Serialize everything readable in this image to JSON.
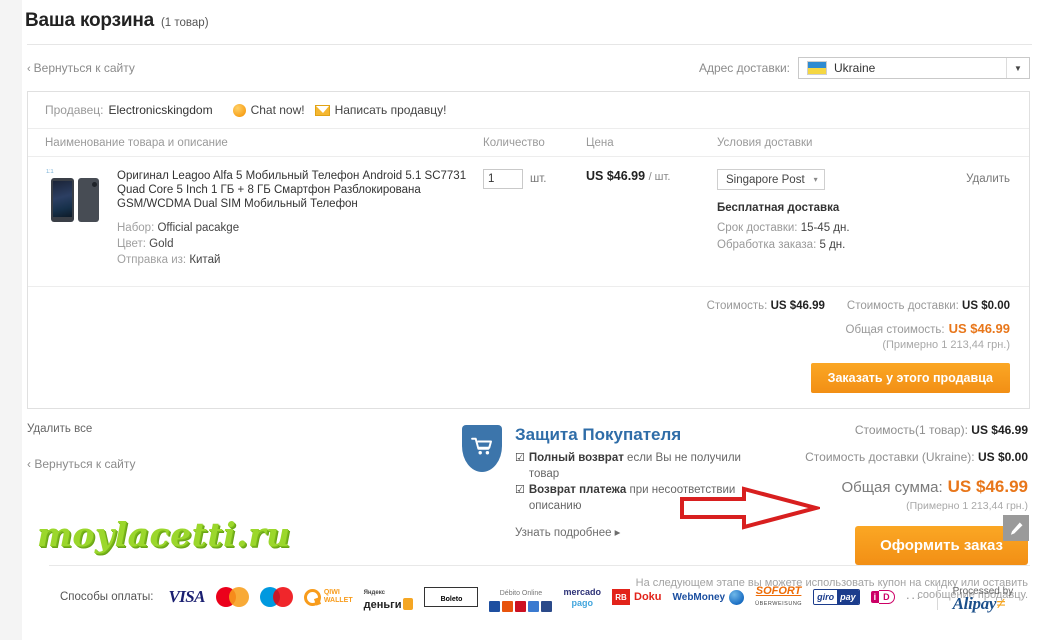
{
  "header": {
    "title": "Ваша корзина",
    "count": "(1 товар)"
  },
  "topbar": {
    "back_link": "Вернуться к сайту",
    "back_chevron": "‹",
    "shipping_address_label": "Адрес доставки:",
    "shipping_country": "Ukraine",
    "shipping_flag_icon": "ukraine-flag-icon",
    "dropdown_arrow": "▼"
  },
  "seller": {
    "label": "Продавец:",
    "name": "Electronicskingdom",
    "chat_label": "Chat now!",
    "chat_icon": "chat-bubble-icon",
    "mail_label": "Написать продавцу!",
    "mail_icon": "envelope-icon"
  },
  "columns": {
    "description": "Наименование товара и описание",
    "quantity": "Количество",
    "price": "Цена",
    "shipping": "Условия доставки"
  },
  "item": {
    "thumb_badge": "1:1",
    "title": "Оригинал Leagoo Alfa 5 Мобильный Телефон Android 5.1 SC7731 Quad Core 5 Inch 1 ГБ + 8 ГБ Смартфон Разблокирована GSM/WCDMA Dual SIM Mo­бильный Телефон",
    "attrs": [
      {
        "label": "Набор:",
        "value": "Official pacakge"
      },
      {
        "label": "Цвет:",
        "value": "Gold"
      },
      {
        "label": "Отправка из:",
        "value": "Китай"
      }
    ],
    "qty_value": "1",
    "qty_unit": "шт.",
    "price": "US $46.99",
    "price_per": "/ шт.",
    "ship_method": "Singapore Post",
    "ship_arrow": "▾",
    "free_shipping": "Бесплатная доставка",
    "ship_time_label": "Срок доставки:",
    "ship_time_value": "15-45 дн.",
    "process_label": "Обработка заказа:",
    "process_value": "5 дн.",
    "delete_label": "Удалить"
  },
  "card_footer": {
    "cost_label": "Стоимость:",
    "cost_value": "US $46.99",
    "ship_cost_label": "Стоимость доставки:",
    "ship_cost_value": "US $0.00",
    "total_label": "Общая стоимость:",
    "total_value": "US $46.99",
    "approx": "(Примерно 1 213,44 грн.)",
    "order_button": "Заказать у этого продавца"
  },
  "mid": {
    "delete_all": "Удалить все",
    "back_link": "Вернуться к сайту",
    "back_chevron": "‹",
    "watermark": "moylacetti.ru"
  },
  "protection": {
    "shield_icon": "shield-cart-icon",
    "title": "Защита Покупателя",
    "items": [
      {
        "check": "☑",
        "strong": "Полный возврат",
        "rest": " если Вы не получили товар"
      },
      {
        "check": "☑",
        "strong": "Возврат платежа",
        "rest": " при несоответствии описанию"
      }
    ],
    "more_link": "Узнать подробнее ▸"
  },
  "summary": {
    "cost_label": "Стоимость(1 товар):",
    "cost_value": "US $46.99",
    "ship_label": "Стоимость доставки (Ukraine):",
    "ship_value": "US $0.00",
    "grand_label": "Общая сумма:",
    "grand_value": "US $46.99",
    "grand_approx": "(Примерно 1 213,44 грн.)",
    "checkout_button": "Оформить заказ",
    "next_step_note": "На следующем этапе вы можете использовать купон на скидку или оставить сообщение продавцу."
  },
  "annotation": {
    "arrow_color": "#d81f1f",
    "arrow_icon": "red-arrow-right-annotation",
    "edit_tool_icon": "pencil-icon"
  },
  "payments": {
    "label": "Способы оплаты:",
    "methods": [
      "VISA",
      "MasterCard",
      "Maestro",
      "QIWI WALLET",
      "Яндекс.Деньги",
      "Boleto",
      "Débito Online",
      "mercado pago",
      "Doku",
      "WebMoney",
      "SOFORT ÜBERWEISUNG",
      "giropay",
      "iDEAL"
    ],
    "more": "···",
    "processed_by": "Processed by",
    "processor": "Alipay",
    "visa_text": "VISA",
    "mastercard_text": "MasterCard",
    "maestro_text": "Maestro",
    "qiwi_line1": "QIWI",
    "qiwi_line2": "WALLET",
    "yandex_line1": "Яндекс",
    "yandex_line2": "деньги",
    "boleto_text": "Boleto",
    "debito_top": "Débito Online",
    "mercado_1": "mercado",
    "mercado_2": "pago",
    "doku_mark": "RB",
    "doku_text": "Doku",
    "webmoney_text": "WebMoney",
    "sofort_1": "SOFORT",
    "sofort_2": "ÜBERWEISUNG",
    "giro_1": "giro",
    "giro_2": "pay",
    "ideal_1": "i",
    "ideal_2": "D"
  }
}
